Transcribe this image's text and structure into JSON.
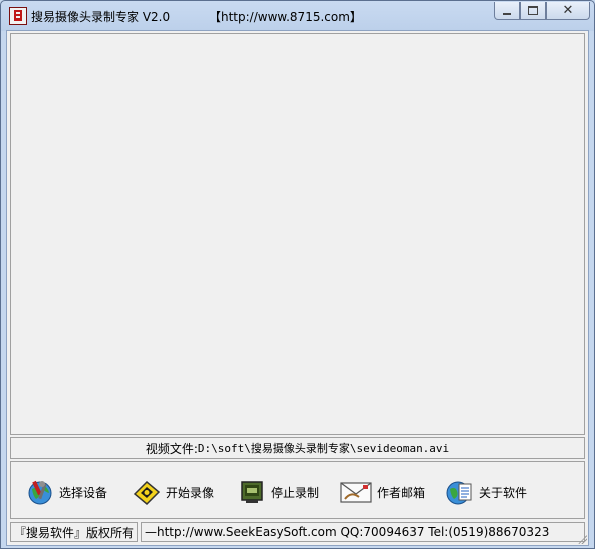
{
  "window": {
    "title": "搜易摄像头录制专家 V2.0",
    "url": "【http://www.8715.com】"
  },
  "file_path": {
    "label": "视频文件:",
    "value": "D:\\soft\\搜易摄像头录制专家\\sevideoman.avi"
  },
  "toolbar": {
    "select_device": "选择设备",
    "start_record": "开始录像",
    "stop_record": "停止录制",
    "author_email": "作者邮箱",
    "about": "关于软件"
  },
  "status": {
    "copyright": "『搜易软件』版权所有",
    "contact": "—http://www.SeekEasySoft.com  QQ:70094637  Tel:(0519)88670323"
  },
  "icons": {
    "app": "app-logo-icon",
    "select_device": "gear-globe-icon",
    "start_record": "camera-start-icon",
    "stop_record": "monitor-stop-icon",
    "author_email": "envelope-icon",
    "about": "document-globe-icon"
  }
}
